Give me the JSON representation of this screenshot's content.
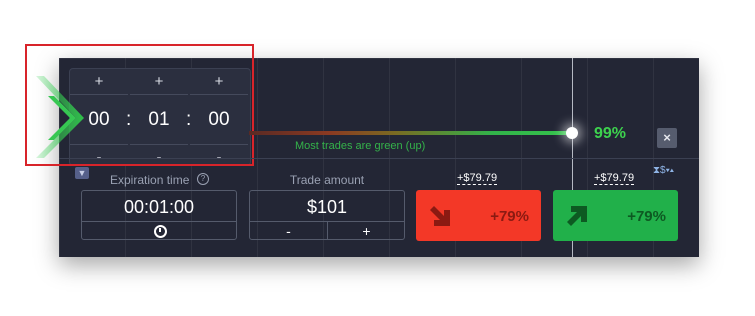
{
  "picker": {
    "plus_hours": "+",
    "plus_minutes": "+",
    "plus_seconds": "+",
    "hours": "00",
    "minutes": "01",
    "seconds": "00",
    "colon1": ":",
    "colon2": ":",
    "minus_hours": "-",
    "minus_minutes": "-",
    "minus_seconds": "-"
  },
  "sentiment": {
    "percent": "99%",
    "percent_value": 0.99,
    "message": "Most trades are green (up)",
    "close_label": "×"
  },
  "expiration": {
    "label": "Expiration time",
    "help_icon": "?",
    "value": "00:01:00",
    "clock_icon": "clock-icon"
  },
  "amount": {
    "label": "Trade amount",
    "value": "$101",
    "minus_label": "-",
    "plus_label": "+"
  },
  "sell": {
    "payout": "+$79.79",
    "percent": "+79%",
    "icon": "arrow-down-right-icon",
    "color": "#f33827"
  },
  "buy": {
    "payout": "+$79.79",
    "percent": "+79%",
    "icon": "arrow-up-right-icon",
    "color": "#21b04a"
  },
  "toolbar": {
    "settings_icon": "⧗$▾▴"
  },
  "dropdown_icon": "▼",
  "colors": {
    "accent_green": "#3dd24e",
    "highlight_red": "#d8242a",
    "panel_bg": "#232635"
  }
}
